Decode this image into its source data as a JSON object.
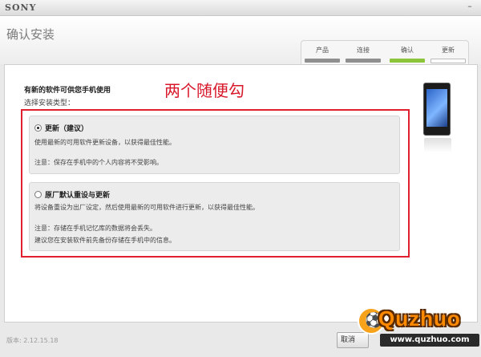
{
  "window": {
    "brand": "SONY",
    "minimize_glyph": "–"
  },
  "header": {
    "title": "确认安装",
    "steps": [
      {
        "label": "产品",
        "state": "done"
      },
      {
        "label": "连接",
        "state": "done"
      },
      {
        "label": "确认",
        "state": "active"
      },
      {
        "label": "更新",
        "state": "pending"
      }
    ]
  },
  "main": {
    "heading": "有新的软件可供您手机使用",
    "subheading": "选择安装类型：",
    "annotation": "两个随便勾",
    "options": [
      {
        "title": "更新（建议）",
        "selected": true,
        "desc1": "使用最新的可用软件更新设备，以获得最佳性能。",
        "desc2": "注意：保存在手机中的个人内容将不受影响。",
        "desc3": ""
      },
      {
        "title": "原厂默认重设与更新",
        "selected": false,
        "desc1": "将设备重设为出厂设定，然后使用最新的可用软件进行更新，以获得最佳性能。",
        "desc2": "注意：存储在手机记忆库的数据将会丢失。",
        "desc3": "建议您在安装软件前先备份存储在手机中的信息。"
      }
    ]
  },
  "footer": {
    "version": "版本: 2.12.15.18",
    "cancel_label": "取消"
  },
  "watermark": {
    "logo": "Quzhuo",
    "url": "www.quzhuo.com"
  },
  "colors": {
    "accent_green": "#8cc43c",
    "annotation_red": "#e0202e"
  }
}
